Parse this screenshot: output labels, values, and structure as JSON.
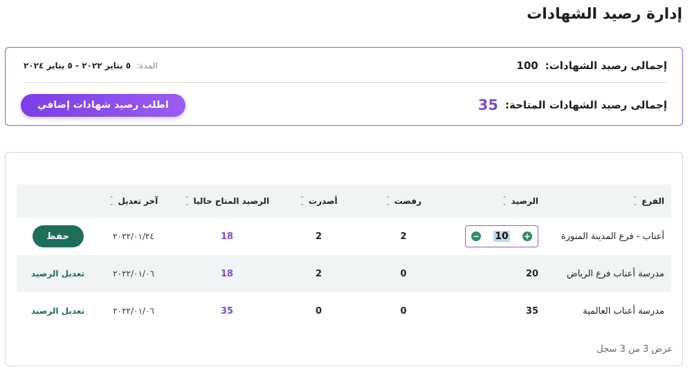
{
  "page": {
    "title": "إدارة رصيد الشهادات"
  },
  "summary": {
    "total_label": "إجمالى رصيد الشهادات:",
    "total_value": "100",
    "period_label": "المدة:",
    "period_value": "٥ يناير ٢٠٢٢ - ٥ يناير ٢٠٢٤",
    "available_label": "إجمالى رصيد الشهادات المتاحة:",
    "available_value": "35",
    "request_button": "اطلب رصيد شهادات إضافي"
  },
  "table": {
    "columns": [
      "الفرع",
      "الرصيد",
      "رفضت",
      "أصدرت",
      "الرصيد المتاح حاليا",
      "آخر تعديل"
    ],
    "rows": [
      {
        "branch": "أعناب - فرع المدينة المنورة",
        "balance": "10",
        "rejected": "2",
        "issued": "2",
        "available": "18",
        "modified": "٢٠٢٢/٠١/٢٤",
        "action": "حفظ",
        "editing": true
      },
      {
        "branch": "مدرسة أعناب فرع الرياض",
        "balance": "20",
        "rejected": "0",
        "issued": "2",
        "available": "18",
        "modified": "٢٠٢٢/٠١/٠٦",
        "action": "تعديل الرصيد",
        "editing": false
      },
      {
        "branch": "مدرسة أعناب العالمية",
        "balance": "35",
        "rejected": "0",
        "issued": "0",
        "available": "35",
        "modified": "٢٠٢٢/٠١/٠٦",
        "action": "تعديل الرصيد",
        "editing": false
      }
    ],
    "footer": "عرض 3 من 3 سجل"
  },
  "icons": {
    "sort": "sort-icon",
    "minus": "minus-circle-icon",
    "plus": "plus-circle-icon"
  },
  "colors": {
    "accent": "#7b4dd0",
    "primary_green": "#1f6e5a",
    "header_bg": "#f1f4f4"
  }
}
